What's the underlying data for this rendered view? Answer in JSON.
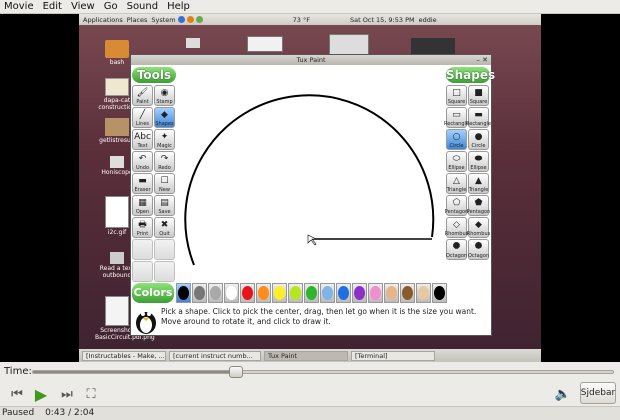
{
  "menubar": [
    "Movie",
    "Edit",
    "View",
    "Go",
    "Sound",
    "Help"
  ],
  "panel": {
    "applications": "Applications",
    "places": "Places",
    "system": "System",
    "weather": "73 °F",
    "datetime": "Sat Oct 15,  9:53 PM",
    "user": "eddie"
  },
  "desktop_icons": [
    "bash",
    "dapa-cat construction",
    "getlistresult",
    "Honiscope",
    "i2c.gif",
    "Read a text outbound",
    "Screenshot BasicCircuit.pdf.png"
  ],
  "taskbar": [
    "[Instructables - Make, ...",
    "[current instruct numb...",
    "Tux Paint",
    "[Terminal]"
  ],
  "tuxpaint": {
    "title": "Tux Paint",
    "tools_header": "Tools",
    "shapes_header": "Shapes",
    "colors_header": "Colors",
    "tools": [
      "Paint",
      "Stamp",
      "Lines",
      "Shapes",
      "Text",
      "Magic",
      "Undo",
      "Redo",
      "Eraser",
      "New",
      "Open",
      "Save",
      "Print",
      "Quit"
    ],
    "tool_glyphs": [
      "🖌",
      "◉",
      "╱",
      "◆",
      "Abc",
      "✦",
      "↶",
      "↷",
      "▬",
      "☐",
      "▦",
      "▤",
      "🖶",
      "✖"
    ],
    "shapes": [
      "Square",
      "Square",
      "Rectangle",
      "Rectangle",
      "Circle",
      "Circle",
      "Ellipse",
      "Ellipse",
      "Triangle",
      "Triangle",
      "Pentagon",
      "Pentagon",
      "Rhombus",
      "Rhombus",
      "Octagon",
      "Octagon"
    ],
    "message": "Pick a shape. Click to pick the center, drag, then let go when it is the size you want. Move around to rotate it, and click to draw it.",
    "palette": [
      "#000000",
      "#777777",
      "#a9a9a9",
      "#ffffff",
      "#e8141b",
      "#ff8c1a",
      "#ffee22",
      "#b6e61c",
      "#2db52d",
      "#7fb4e8",
      "#1f6fe0",
      "#8b2fc8",
      "#f08fd0",
      "#e8b48c",
      "#8a5a2b",
      "#e8c8a0",
      "#000000"
    ]
  },
  "player": {
    "time_label": "Time:",
    "progress": 0.35,
    "sidebar_label": "Sjdebar",
    "status": "Paused",
    "time_readout": "0:43 / 2:04"
  }
}
